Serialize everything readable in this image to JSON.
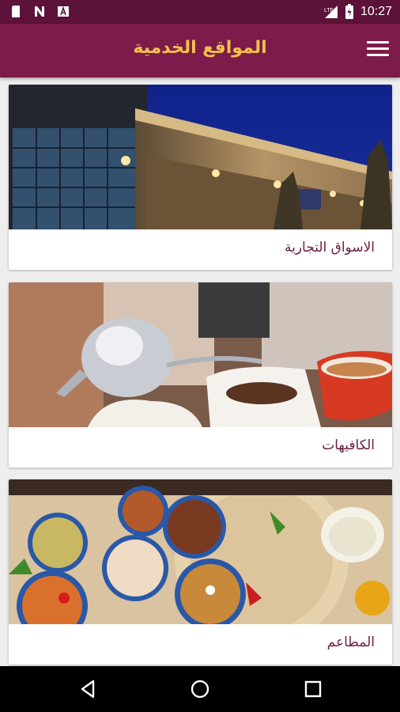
{
  "status_bar": {
    "time": "10:27",
    "left_icons": [
      "sd-card-icon",
      "n-icon",
      "a-icon"
    ],
    "network": "LTE"
  },
  "app_bar": {
    "title": "المواقع الخدمية",
    "title_color": "#f2c14e",
    "background": "#7d1c4a"
  },
  "cards": [
    {
      "label": "الاسواق التجارية",
      "image": "shopping-mall-photo"
    },
    {
      "label": "الكافيهات",
      "image": "coffee-pour-photo"
    },
    {
      "label": "المطاعم",
      "image": "food-dishes-photo"
    }
  ],
  "nav_bar": {
    "buttons": [
      "back-icon",
      "home-icon",
      "recents-icon"
    ]
  }
}
